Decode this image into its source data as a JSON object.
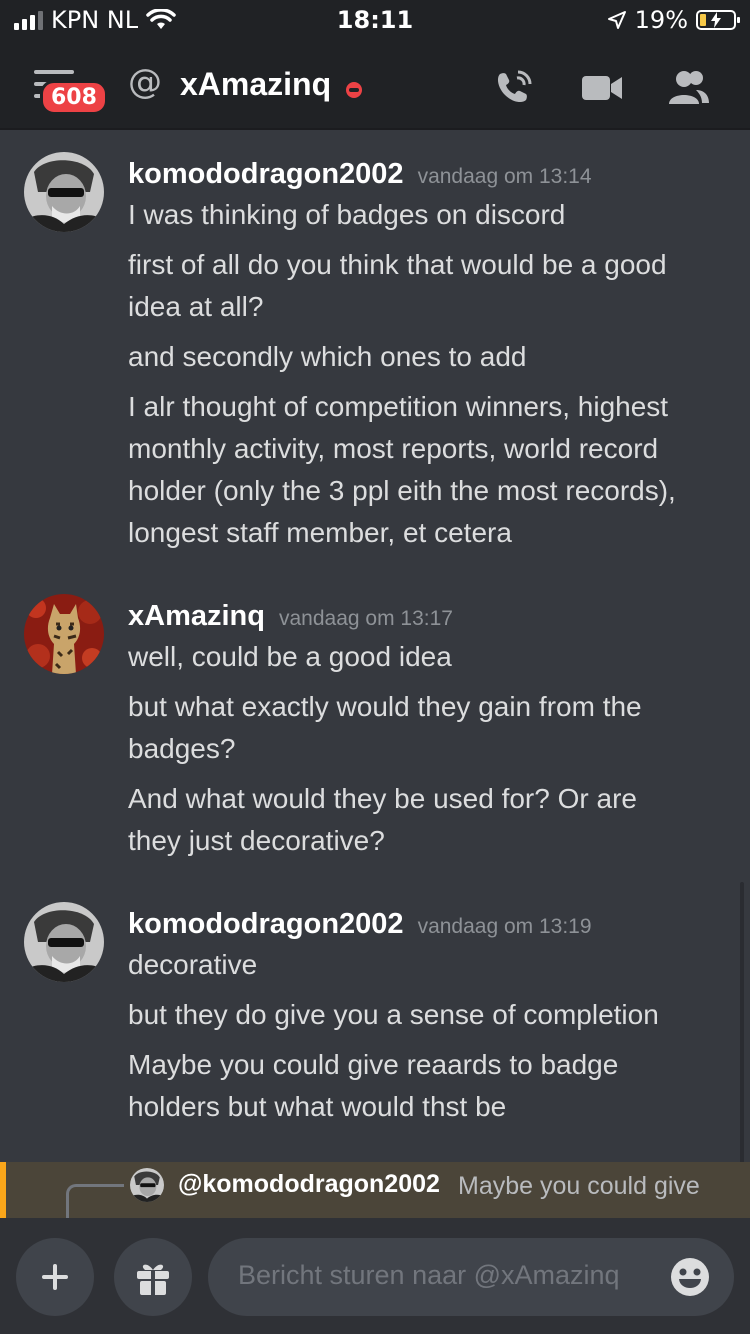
{
  "status_bar": {
    "carrier": "KPN NL",
    "time": "18:11",
    "battery_percent": "19%",
    "battery_level": 0.19
  },
  "header": {
    "unread_badge": "608",
    "at_symbol": "@",
    "channel_name": "xAmazinq",
    "icons": [
      "menu-icon",
      "at-icon",
      "dnd-status-icon",
      "phone-call-icon",
      "video-call-icon",
      "members-icon"
    ]
  },
  "messages": [
    {
      "author": "komododragon2002",
      "timestamp": "vandaag om 13:14",
      "lines": [
        "I was thinking of badges on discord",
        "first of all do you think that would be a good",
        "idea at all?",
        "and secondly which ones to add",
        "I alr thought of competition winners, highest",
        "monthly activity, most reports, world record",
        "holder (only the 3 ppl eith the most records),",
        "longest staff member, et cetera"
      ]
    },
    {
      "author": "xAmazinq",
      "timestamp": "vandaag om 13:17",
      "lines": [
        "well, could be a good idea",
        "but what exactly would they gain from the",
        "badges?",
        "And what would they be used for? Or are",
        "they just decorative?"
      ]
    },
    {
      "author": "komododragon2002",
      "timestamp": "vandaag om 13:19",
      "lines": [
        "decorative",
        "but they do give you a sense of completion",
        "Maybe you could give reaards to badge",
        "holders but what would thst be"
      ]
    }
  ],
  "reply": {
    "author": "@komododragon2002",
    "text": "Maybe you could give"
  },
  "composer": {
    "placeholder": "Bericht sturen naar @xAmazinq"
  },
  "colors": {
    "background": "#36393f",
    "header": "#202225",
    "accent_dnd": "#ed4245",
    "reply_highlight": "#faa61a"
  }
}
